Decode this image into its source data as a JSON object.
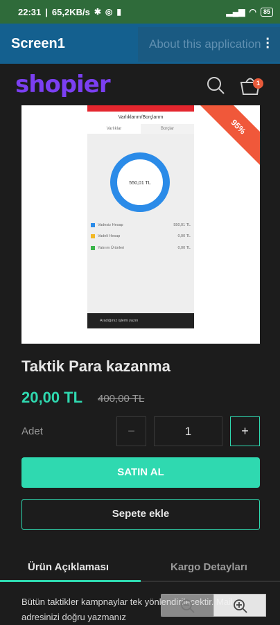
{
  "status_bar": {
    "time": "22:31",
    "speed": "65,2KB/s",
    "battery": "85"
  },
  "app_bar": {
    "title": "Screen1",
    "menu_item": "About this application"
  },
  "shop": {
    "logo": "shopier",
    "cart_count": "1"
  },
  "product": {
    "title": "Taktik Para kazanma",
    "price": "20,00 TL",
    "old_price": "400,00 TL",
    "discount": "95%",
    "image": {
      "screen_title": "Varlıklarım/Borçlarım",
      "tab1": "Varlıklar",
      "tab2": "Borçlar",
      "ring_label": "550,01 TL",
      "rows": [
        {
          "label": "Vadesiz Hesap",
          "value": "550,01 TL",
          "color": "#2b8be8"
        },
        {
          "label": "Vadeli Hesap",
          "value": "0,00 TL",
          "color": "#f2b824"
        },
        {
          "label": "Yatırım Ürünleri",
          "value": "0,00 TL",
          "color": "#3bb54a"
        }
      ],
      "search_text": "Aradığınız işlemi yazın"
    }
  },
  "quantity": {
    "label": "Adet",
    "value": "1",
    "minus": "−",
    "plus": "+"
  },
  "buttons": {
    "buy": "SATIN AL",
    "add_to_cart": "Sepete ekle"
  },
  "tabs": {
    "description": "Ürün Açıklaması",
    "cargo": "Kargo Detayları"
  },
  "description": "Bütün taktikler kampnaylar tek yönlendirilecektir. Mail adresinizi doğru yazmanız",
  "colors": {
    "accent": "#2fd9b0",
    "brand": "#7b3ff2",
    "appbar": "#14608f",
    "statusbar": "#2f6b3a"
  }
}
